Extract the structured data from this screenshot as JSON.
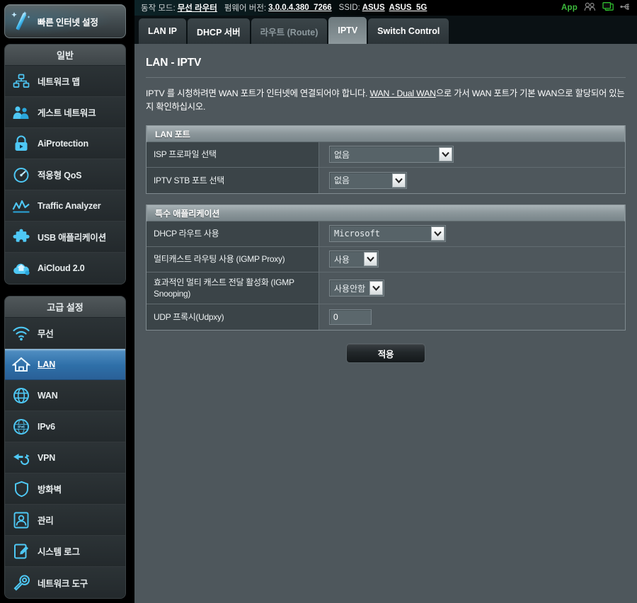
{
  "topbar": {
    "mode_label": "동작 모드:",
    "mode_value": "무선 라우터",
    "firmware_label": "펌웨어 버전:",
    "firmware_value": "3.0.0.4.380_7266",
    "ssid_label": "SSID:",
    "ssid_value_1": "ASUS",
    "ssid_value_2": "ASUS_5G",
    "app_label": "App",
    "icons": [
      "clients-icon",
      "usb-monitor-icon",
      "usb-icon"
    ],
    "accent_green": "#3dbb3d"
  },
  "sidebar": {
    "quick_setup_label": "빠른 인터넷 설정",
    "general": {
      "title": "일반",
      "items": [
        {
          "label": "네트워크 맵",
          "icon": "network-map-icon"
        },
        {
          "label": "게스트 네트워크",
          "icon": "guest-network-icon"
        },
        {
          "label": "AiProtection",
          "icon": "lock-shield-icon"
        },
        {
          "label": "적응형 QoS",
          "icon": "speedometer-icon"
        },
        {
          "label": "Traffic Analyzer",
          "icon": "traffic-chart-icon"
        },
        {
          "label": "USB 애플리케이션",
          "icon": "puzzle-icon"
        },
        {
          "label": "AiCloud 2.0",
          "icon": "cloud-home-icon"
        }
      ]
    },
    "advanced": {
      "title": "고급 설정",
      "items": [
        {
          "label": "무선",
          "icon": "wifi-icon",
          "active": false
        },
        {
          "label": "LAN",
          "icon": "home-icon",
          "active": true
        },
        {
          "label": "WAN",
          "icon": "globe-icon",
          "active": false
        },
        {
          "label": "IPv6",
          "icon": "ipv6-globe-icon",
          "active": false
        },
        {
          "label": "VPN",
          "icon": "vpn-key-icon",
          "active": false
        },
        {
          "label": "방화벽",
          "icon": "shield-icon",
          "active": false
        },
        {
          "label": "관리",
          "icon": "user-admin-icon",
          "active": false
        },
        {
          "label": "시스템 로그",
          "icon": "log-edit-icon",
          "active": false
        },
        {
          "label": "네트워크 도구",
          "icon": "wrench-icon",
          "active": false
        }
      ]
    },
    "active_accent": "#2e6fa8"
  },
  "main": {
    "tabs": [
      {
        "label": "LAN IP",
        "active": false,
        "dim": false
      },
      {
        "label": "DHCP 서버",
        "active": false,
        "dim": false
      },
      {
        "label": "라우트 (Route)",
        "active": false,
        "dim": true
      },
      {
        "label": "IPTV",
        "active": true,
        "dim": false
      },
      {
        "label": "Switch Control",
        "active": false,
        "dim": false
      }
    ],
    "page_title": "LAN - IPTV",
    "description_part1": "IPTV 를 시청하려면 WAN 포트가 인터넷에 연결되어야 합니다. ",
    "description_link": "WAN - Dual WAN",
    "description_part2": "으로 가서 WAN 포트가 기본 WAN으로 할당되어 있는지 확인하십시오.",
    "sections": [
      {
        "title": "LAN 포트",
        "rows": [
          {
            "label": "ISP 프로파일 선택",
            "control": "select",
            "value": "없음"
          },
          {
            "label": "IPTV STB 포트 선택",
            "control": "select",
            "value": "없음"
          }
        ]
      },
      {
        "title": "특수 애플리케이션",
        "rows": [
          {
            "label": "DHCP 라우트 사용",
            "control": "select",
            "value": "Microsoft"
          },
          {
            "label": "멀티캐스트 라우팅 사용 (IGMP Proxy)",
            "control": "select",
            "value": "사용"
          },
          {
            "label": "효과적인 멀티 캐스트 전달 활성화 (IGMP Snooping)",
            "control": "select",
            "value": "사용안함"
          },
          {
            "label": "UDP 프록시(Udpxy)",
            "control": "input",
            "value": "0"
          }
        ]
      }
    ],
    "apply_label": "적용"
  }
}
